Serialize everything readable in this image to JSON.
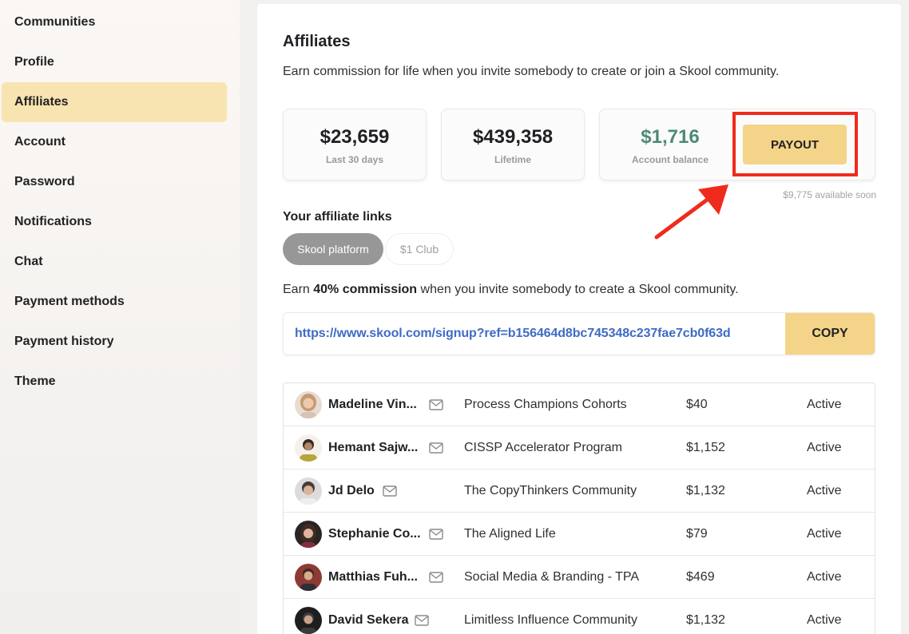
{
  "sidebar": {
    "items": [
      {
        "label": "Communities",
        "active": false
      },
      {
        "label": "Profile",
        "active": false
      },
      {
        "label": "Affiliates",
        "active": true
      },
      {
        "label": "Account",
        "active": false
      },
      {
        "label": "Password",
        "active": false
      },
      {
        "label": "Notifications",
        "active": false
      },
      {
        "label": "Chat",
        "active": false
      },
      {
        "label": "Payment methods",
        "active": false
      },
      {
        "label": "Payment history",
        "active": false
      },
      {
        "label": "Theme",
        "active": false
      }
    ]
  },
  "main": {
    "title": "Affiliates",
    "subtitle": "Earn commission for life when you invite somebody to create or join a Skool community.",
    "stats": {
      "last30": {
        "value": "$23,659",
        "label": "Last 30 days"
      },
      "lifetime": {
        "value": "$439,358",
        "label": "Lifetime"
      },
      "balance": {
        "value": "$1,716",
        "label": "Account balance"
      }
    },
    "payout_label": "PAYOUT",
    "available_soon": "$9,775 available soon",
    "links_title": "Your affiliate links",
    "tabs": [
      {
        "label": "Skool platform",
        "active": true
      },
      {
        "label": "$1 Club",
        "active": false
      }
    ],
    "commission": {
      "prefix": "Earn ",
      "bold": "40% commission",
      "suffix": " when you invite somebody to create a Skool community."
    },
    "link_url": "https://www.skool.com/signup?ref=b156464d8bc745348c237fae7cb0f63d",
    "copy_label": "COPY",
    "referrals": [
      {
        "name": "Madeline Vin...",
        "community": "Process Champions Cohorts",
        "amount": "$40",
        "status": "Active"
      },
      {
        "name": "Hemant Sajw...",
        "community": "CISSP Accelerator Program",
        "amount": "$1,152",
        "status": "Active"
      },
      {
        "name": "Jd Delo",
        "community": "The CopyThinkers Community",
        "amount": "$1,132",
        "status": "Active"
      },
      {
        "name": "Stephanie Co...",
        "community": "The Aligned Life",
        "amount": "$79",
        "status": "Active"
      },
      {
        "name": "Matthias Fuh...",
        "community": "Social Media & Branding - TPA",
        "amount": "$469",
        "status": "Active"
      },
      {
        "name": "David Sekera",
        "community": "Limitless Influence Community",
        "amount": "$1,132",
        "status": "Active"
      }
    ]
  },
  "icons": {
    "mail": "mail-icon",
    "arrow": "red-arrow-annotation"
  },
  "colors": {
    "accent_yellow": "#f3d488",
    "active_sidebar": "#f8e4b0",
    "balance_green": "#4e8a74",
    "link_blue": "#3f6bc4",
    "highlight_red": "#ef2b1d"
  }
}
